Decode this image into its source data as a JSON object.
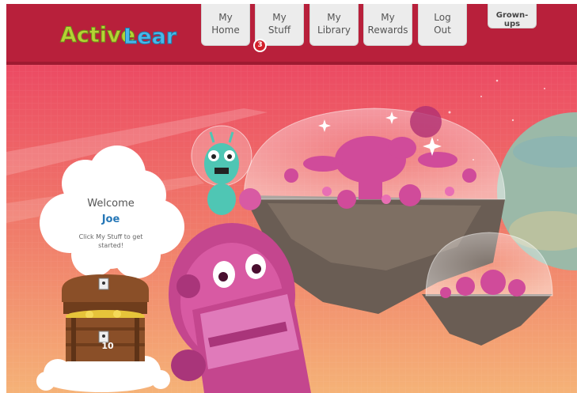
{
  "app": {
    "name": "ActiveLearn"
  },
  "nav": {
    "my_home": [
      "My",
      "Home"
    ],
    "my_stuff": [
      "My",
      "Stuff"
    ],
    "my_library": [
      "My",
      "Library"
    ],
    "my_rewards": [
      "My",
      "Rewards"
    ],
    "log_out": [
      "Log",
      "Out"
    ],
    "grown_ups": "Grown-ups",
    "stuff_badge": "3"
  },
  "welcome": {
    "title": "Welcome",
    "name": "Joe",
    "hint": "Click My Stuff to get started!"
  },
  "treasure": {
    "coins": "10"
  },
  "colors": {
    "header": "#b8203b",
    "logo_green": "#b5d334",
    "logo_blue": "#4ab8e8",
    "name_blue": "#2677b7",
    "badge_red": "#d3212b"
  }
}
